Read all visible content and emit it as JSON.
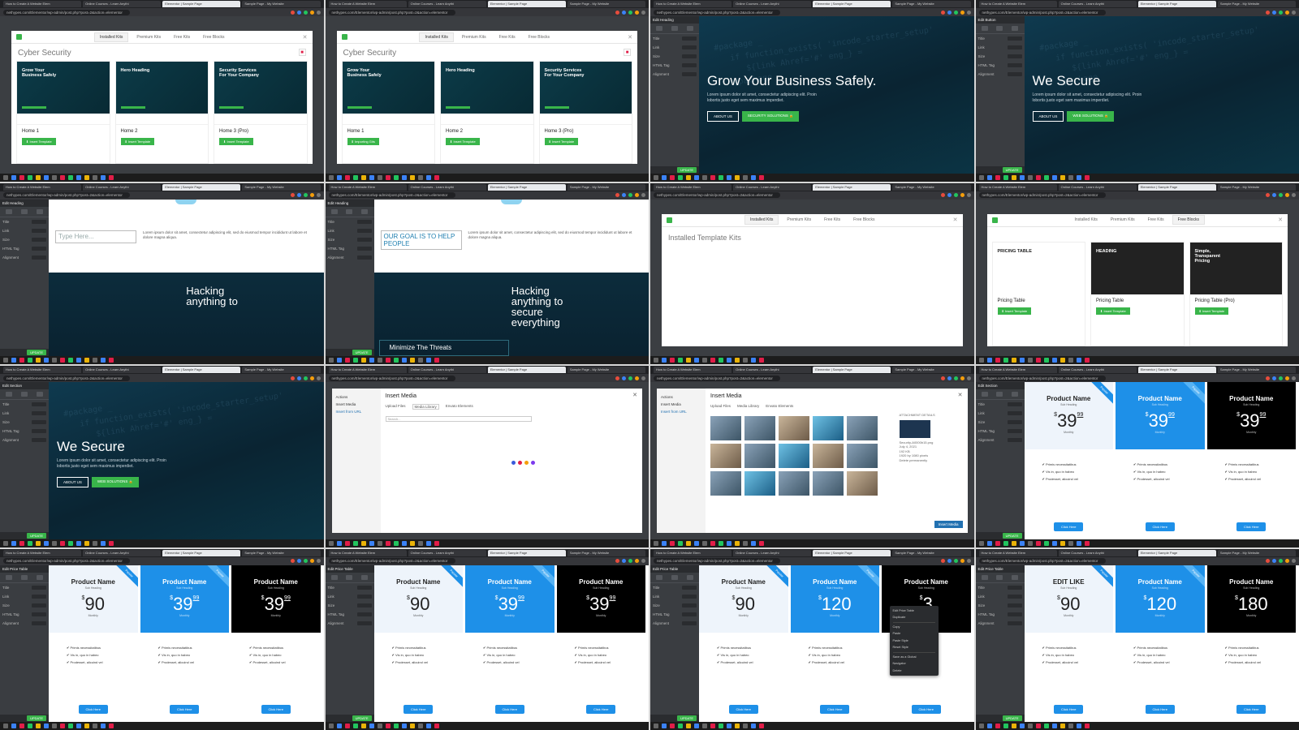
{
  "browser": {
    "tabs": [
      "How to Create A Website Elem",
      "Online Courses - Learn Anythi",
      "Elementor | Sample Page",
      "Sample Page - My Website"
    ],
    "url": "nethypes.com/Elementor/wp-admin/post.php?post=2&action=elementor"
  },
  "panel": {
    "edit_heading": "Edit Heading",
    "edit_button": "Edit Button",
    "edit_section": "Edit Section",
    "edit_price_table": "Edit Price Table",
    "rows": [
      "Title",
      "Link",
      "Size",
      "HTML Tag",
      "Alignment"
    ],
    "update": "UPDATE"
  },
  "library": {
    "tabs": [
      "Installed Kits",
      "Premium Kits",
      "Free Kits",
      "Free Blocks"
    ],
    "kit_title": "Cyber Security",
    "cards": [
      {
        "name": "Home 1",
        "heading": "Grow Your Business Safely"
      },
      {
        "name": "Home 2",
        "heading": "Hero Heading"
      },
      {
        "name": "Home 3 (Pro)",
        "heading": "Security Services For Your Company"
      }
    ],
    "insert_label": "Insert Template",
    "importing_label": "Importing Gits",
    "installed_title": "Installed Template Kits",
    "pricing_cards": [
      {
        "name": "Pricing Table",
        "heading": "PRICING TABLE"
      },
      {
        "name": "Pricing Table",
        "heading": "HEADING"
      },
      {
        "name": "Pricing Table (Pro)",
        "heading": "Simple, Transparent Pricing"
      }
    ]
  },
  "hero": {
    "title1": "Grow Your Business Safely.",
    "title2": "We Secure",
    "body": "Lorem ipsum dolor sit amet, consectetur adipiscing elit. Proin lobortis justo eget sem maximus imperdiet.",
    "btn_about": "ABOUT US",
    "btn_security": "SECURITY SOLUTIONS",
    "btn_web": "WEB SOLUTIONS",
    "code": "#package _\n   if function_exists( 'incode_starter_setup'\n      ${link Ahref='#' eng_} =\n   @package"
  },
  "about": {
    "placeholder": "Type Here...",
    "goal": "OUR GOAL IS TO HELP PEOPLE",
    "lorem": "Lorem ipsum dolor sit amet, consectetur adipiscing elit, sed do eiusmod tempor incididunt ut labore et dolore magna aliqua.",
    "hacking": "Hacking anything to",
    "hacking2": "Hacking anything to secure everything",
    "threats": "Minimize The Threats"
  },
  "media": {
    "title": "Insert Media",
    "side": [
      "Actions",
      "Insert Media",
      "Insert from URL"
    ],
    "tabs": [
      "Upload Files",
      "Media Library",
      "Envato Elements"
    ],
    "search": "Search...",
    "details_title": "ATTACHMENT DETAILS",
    "details_lines": [
      "Security-A0000b15.png",
      "July 4, 2021",
      "192 KB",
      "1920 by 1080 pixels",
      "Delete permanently"
    ],
    "insert_btn": "Insert Media",
    "loader_colors": [
      "#3b5bdb",
      "#e11d48",
      "#f59e0b",
      "#7c3aed"
    ]
  },
  "pricing": {
    "name": "Product Name",
    "edit_name": "EDIT LIKE",
    "sub": "Sub Heading",
    "period": "Monthly",
    "currency": "$",
    "ribbon": "Popular",
    "features": [
      "Primis necessitatibus",
      "Vis in, quo in habeo",
      "Prodesset, alicuind vel"
    ],
    "cta": "Click Here",
    "tile_prices": [
      [
        [
          "39",
          "99"
        ],
        [
          "39",
          "99"
        ],
        [
          "39",
          "99"
        ]
      ],
      [
        [
          "90",
          ""
        ],
        [
          "39",
          "99"
        ],
        [
          "39",
          "99"
        ]
      ],
      [
        [
          "90",
          ""
        ],
        [
          "39",
          "99"
        ],
        [
          "39",
          "99"
        ]
      ],
      [
        [
          "90",
          ""
        ],
        [
          "120",
          ""
        ],
        [
          "3",
          ""
        ]
      ],
      [
        [
          "90",
          ""
        ],
        [
          "120",
          ""
        ],
        [
          "180",
          ""
        ]
      ]
    ]
  },
  "context_menu": [
    "Edit Price Table",
    "Duplicate",
    "Copy",
    "Paste",
    "Paste Style",
    "Reset Style",
    "Save as a Global",
    "Navigator",
    "Delete"
  ],
  "colors": {
    "accent": "#39b54a",
    "blue": "#1e90e8",
    "dark": "#000000",
    "hero": "#0c3144"
  }
}
